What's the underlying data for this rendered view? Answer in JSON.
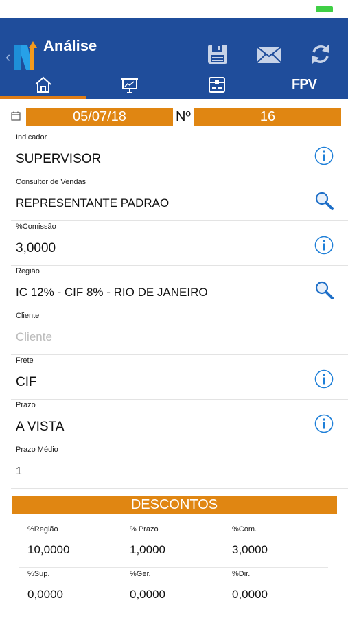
{
  "header": {
    "title": "Análise",
    "back_icon": "chevron-left-icon",
    "actions": [
      "save-icon",
      "mail-icon",
      "sync-icon"
    ],
    "tabs": [
      "home-icon",
      "presentation-chart-icon",
      "box-icon",
      "FPV"
    ],
    "fpv_label": "FPV",
    "colors": {
      "header": "#1f4d9b",
      "accent": "#e08612"
    }
  },
  "order": {
    "date": "05/07/18",
    "number_label": "Nº",
    "number": "16"
  },
  "fields": {
    "indicador": {
      "label": "Indicador",
      "value": "SUPERVISOR"
    },
    "consultor": {
      "label": "Consultor de Vendas",
      "value": "REPRESENTANTE PADRAO"
    },
    "comissao": {
      "label": "%Comissão",
      "value": "3,0000"
    },
    "regiao": {
      "label": "Região",
      "value": "IC 12% - CIF 8% - RIO DE JANEIRO"
    },
    "cliente": {
      "label": "Cliente",
      "placeholder": "Cliente"
    },
    "frete": {
      "label": "Frete",
      "value": "CIF"
    },
    "prazo": {
      "label": "Prazo",
      "value": "A VISTA"
    },
    "prazo_medio": {
      "label": "Prazo Médio",
      "value": "1"
    }
  },
  "descontos": {
    "title": "DESCONTOS",
    "row1": [
      {
        "label": "%Região",
        "value": "10,0000"
      },
      {
        "label": "% Prazo",
        "value": "1,0000"
      },
      {
        "label": "%Com.",
        "value": "3,0000"
      }
    ],
    "row2": [
      {
        "label": "%Sup.",
        "value": "0,0000"
      },
      {
        "label": "%Ger.",
        "value": "0,0000"
      },
      {
        "label": "%Dir.",
        "value": "0,0000"
      }
    ]
  }
}
